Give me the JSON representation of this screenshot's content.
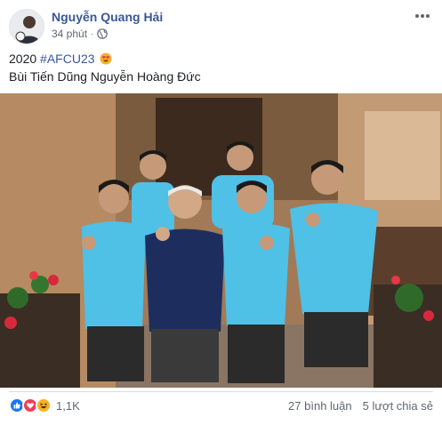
{
  "post": {
    "author": "Nguyễn Quang Hải",
    "time": "34 phút",
    "separator": "·",
    "privacy_icon": "globe-icon",
    "more_icon": "more-horizontal-icon",
    "text_line1_plain": "2020 ",
    "hashtag": "#AFCU23",
    "text_emoji": "heart-eyes-emoji",
    "text_line2": "Bùi Tiến Dũng Nguyễn Hoàng Đức"
  },
  "footer": {
    "reaction_icons": [
      "like-icon",
      "love-icon",
      "haha-icon"
    ],
    "reaction_count": "1,1K",
    "comments": "27 bình luận",
    "shares": "5 lượt chia sẻ"
  },
  "colors": {
    "link": "#385898",
    "shirt_cyan": "#4fc0e6",
    "shirt_navy": "#1d2e5e",
    "like_blue": "#1877f2",
    "love_red": "#f33e58",
    "haha_yellow": "#f7b125"
  }
}
